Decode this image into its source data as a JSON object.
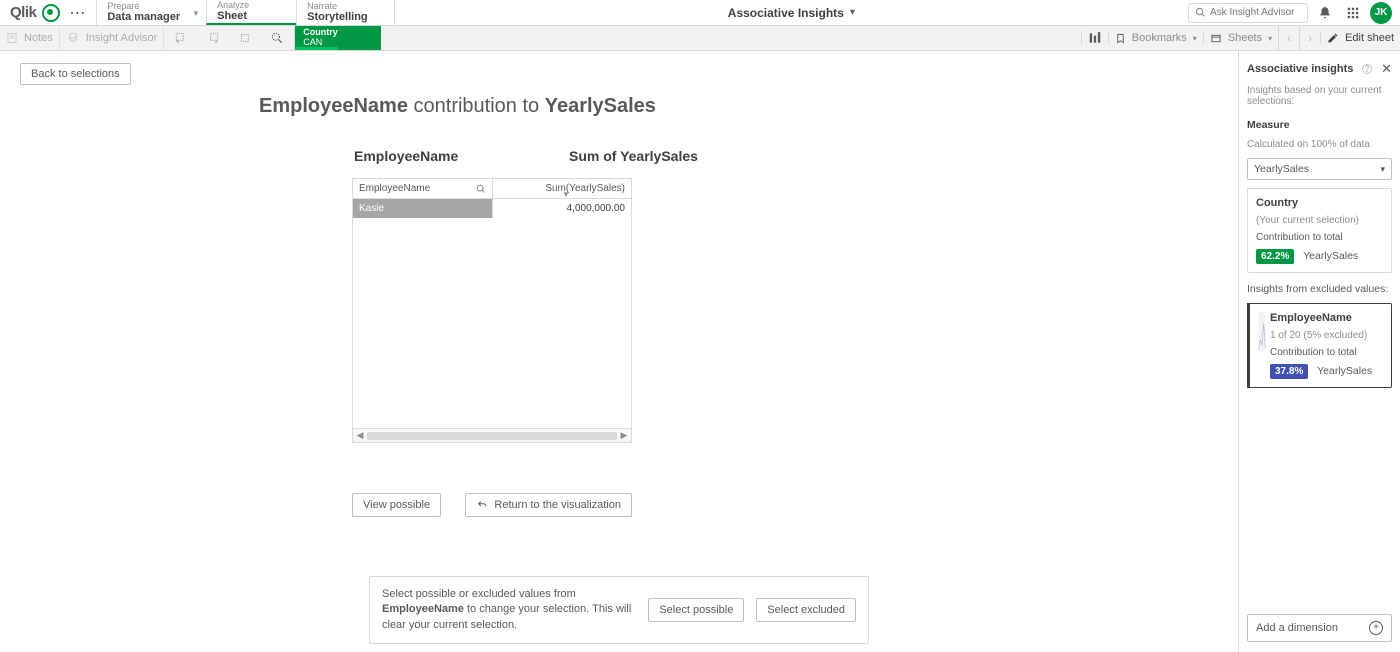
{
  "topbar": {
    "logo_text": "Qlik",
    "nav": [
      {
        "top": "Prepare",
        "bottom": "Data manager",
        "chevron": true
      },
      {
        "top": "Analyze",
        "bottom": "Sheet",
        "active": true
      },
      {
        "top": "Narrate",
        "bottom": "Storytelling"
      }
    ],
    "center_title": "Associative Insights",
    "search_placeholder": "Ask Insight Advisor",
    "avatar": "JK"
  },
  "toolbar": {
    "notes": "Notes",
    "insight_advisor": "Insight Advisor",
    "selection": {
      "field": "Country",
      "value": "CAN"
    },
    "bookmarks": "Bookmarks",
    "sheets": "Sheets",
    "edit_sheet": "Edit sheet"
  },
  "page": {
    "back": "Back to selections",
    "heading_field": "EmployeeName",
    "heading_mid": " contribution to ",
    "heading_measure": "YearlySales",
    "col1": "EmployeeName",
    "col2": "Sum of YearlySales",
    "table": {
      "h1": "EmployeeName",
      "h2": "Sum(YearlySales)",
      "rows": [
        {
          "name": "Kasie",
          "value": "4,000,000.00"
        }
      ]
    },
    "view_possible": "View possible",
    "return_viz": "Return to the visualization",
    "footer_pre": "Select possible or excluded values from ",
    "footer_field": "EmployeeName",
    "footer_post": " to change your selection. This will clear your current selection.",
    "select_possible": "Select possible",
    "select_excluded": "Select excluded"
  },
  "side": {
    "title": "Associative insights",
    "subtitle": "Insights based on your current selections:",
    "measure_label": "Measure",
    "measure_sub": "Calculated on 100% of data",
    "measure_value": "YearlySales",
    "card1": {
      "title": "Country",
      "sub": "(Your current selection)",
      "contrib_label": "Contribution to total",
      "pct": "62.2%",
      "measure": "YearlySales"
    },
    "excluded_label": "Insights from excluded values:",
    "card2": {
      "title": "EmployeeName",
      "sub": "1 of 20 (5% excluded)",
      "contrib_label": "Contribution to total",
      "pct": "37.8%",
      "measure": "YearlySales"
    },
    "add_dimension": "Add a dimension"
  }
}
